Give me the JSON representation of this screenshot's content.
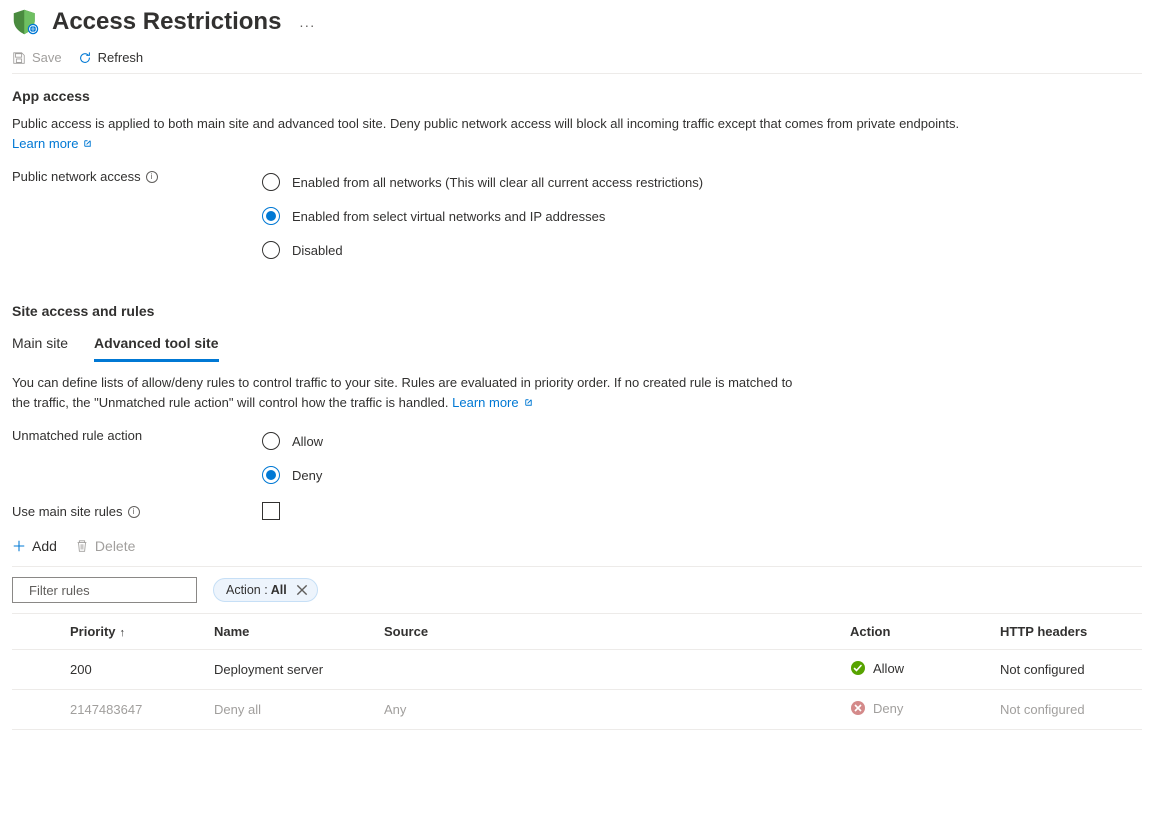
{
  "header": {
    "title": "Access Restrictions",
    "more": "..."
  },
  "toolbar": {
    "save": "Save",
    "refresh": "Refresh"
  },
  "app_access": {
    "heading": "App access",
    "description": "Public access is applied to both main site and advanced tool site. Deny public network access will block all incoming traffic except that comes from private endpoints. ",
    "learn_more": "Learn more",
    "pna_label": "Public network access",
    "radios": [
      "Enabled from all networks (This will clear all current access restrictions)",
      "Enabled from select virtual networks and IP addresses",
      "Disabled"
    ],
    "selected": 1
  },
  "site_rules": {
    "heading": "Site access and rules",
    "tabs": [
      "Main site",
      "Advanced tool site"
    ],
    "active_tab": 1,
    "description": "You can define lists of allow/deny rules to control traffic to your site. Rules are evaluated in priority order. If no created rule is matched to the traffic, the \"Unmatched rule action\" will control how the traffic is handled. ",
    "learn_more": "Learn more",
    "unmatched_label": "Unmatched rule action",
    "unmatched_radios": [
      "Allow",
      "Deny"
    ],
    "unmatched_selected": 1,
    "use_main_label": "Use main site rules",
    "use_main_checked": false
  },
  "rules_toolbar": {
    "add": "Add",
    "delete": "Delete"
  },
  "filter": {
    "placeholder": "Filter rules",
    "pill_label": "Action :",
    "pill_value": "All"
  },
  "table": {
    "columns": [
      "Priority",
      "Name",
      "Source",
      "Action",
      "HTTP headers"
    ],
    "rows": [
      {
        "priority": "200",
        "name": "Deployment server",
        "source": "",
        "action": "Allow",
        "action_type": "allow",
        "http": "Not configured",
        "dim": false
      },
      {
        "priority": "2147483647",
        "name": "Deny all",
        "source": "Any",
        "action": "Deny",
        "action_type": "deny",
        "http": "Not configured",
        "dim": true
      }
    ]
  }
}
